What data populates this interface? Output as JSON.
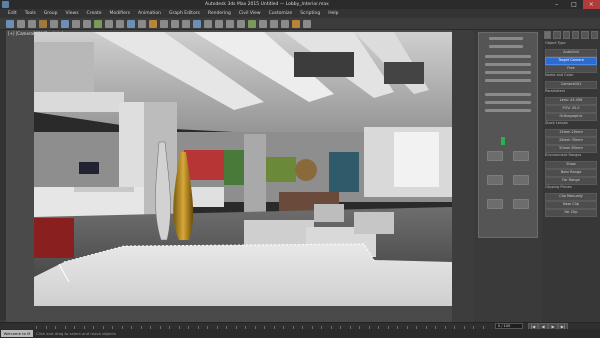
{
  "window": {
    "title": "Autodesk 3ds Max 2015   Untitled — Lobby_Interior.max"
  },
  "menu": [
    "Edit",
    "Tools",
    "Group",
    "Views",
    "Create",
    "Modifiers",
    "Animation",
    "Graph Editors",
    "Rendering",
    "Civil View",
    "Customize",
    "Scripting",
    "Help"
  ],
  "viewport": {
    "label": "[+] [Camera001] [Realistic]"
  },
  "command_panel": {
    "rows": [
      {
        "kind": "head",
        "text": "Object Type"
      },
      {
        "kind": "row",
        "text": "AutoGrid"
      },
      {
        "kind": "row",
        "text": "Target Camera",
        "selected": true
      },
      {
        "kind": "row",
        "text": "Free"
      },
      {
        "kind": "head",
        "text": "Name and Color"
      },
      {
        "kind": "row",
        "text": "Camera001"
      },
      {
        "kind": "head",
        "text": "Parameters"
      },
      {
        "kind": "row",
        "text": "Lens: 43.456"
      },
      {
        "kind": "row",
        "text": "FOV: 45.0"
      },
      {
        "kind": "row",
        "text": "Orthographic"
      },
      {
        "kind": "head",
        "text": "Stock Lenses"
      },
      {
        "kind": "row",
        "text": "15mm   20mm"
      },
      {
        "kind": "row",
        "text": "28mm   35mm"
      },
      {
        "kind": "row",
        "text": "50mm   85mm"
      },
      {
        "kind": "head",
        "text": "Environment Ranges"
      },
      {
        "kind": "row",
        "text": "Show"
      },
      {
        "kind": "row",
        "text": "Near Range"
      },
      {
        "kind": "row",
        "text": "Far Range"
      },
      {
        "kind": "head",
        "text": "Clipping Planes"
      },
      {
        "kind": "row",
        "text": "Clip Manually"
      },
      {
        "kind": "row",
        "text": "Near Clip"
      },
      {
        "kind": "row",
        "text": "Far Clip"
      }
    ]
  },
  "timeline": {
    "frame": "0 / 100"
  },
  "playback": [
    "|◀",
    "◀",
    "▶",
    "▶|"
  ],
  "status": {
    "badge": "Welcome to M",
    "text": "Click and drag to select and move objects"
  },
  "colors": {
    "selected": "#2e6bd1",
    "close": "#b23b3b"
  }
}
